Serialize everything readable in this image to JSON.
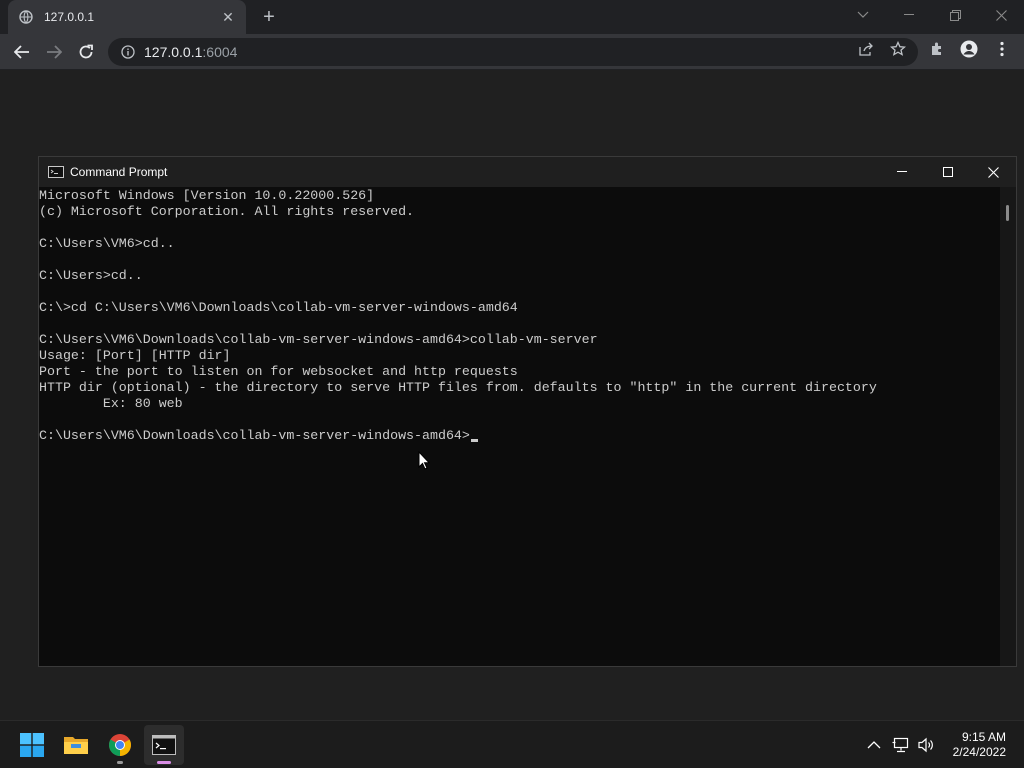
{
  "browser": {
    "tab_title": "127.0.0.1",
    "url_host": "127.0.0.1",
    "url_port": ":6004"
  },
  "cmd": {
    "title": "Command Prompt",
    "lines": [
      "Microsoft Windows [Version 10.0.22000.526]",
      "(c) Microsoft Corporation. All rights reserved.",
      "",
      "C:\\Users\\VM6>cd..",
      "",
      "C:\\Users>cd..",
      "",
      "C:\\>cd C:\\Users\\VM6\\Downloads\\collab-vm-server-windows-amd64",
      "",
      "C:\\Users\\VM6\\Downloads\\collab-vm-server-windows-amd64>collab-vm-server",
      "Usage: [Port] [HTTP dir]",
      "Port - the port to listen on for websocket and http requests",
      "HTTP dir (optional) - the directory to serve HTTP files from. defaults to \"http\" in the current directory",
      "        Ex: 80 web",
      "",
      "C:\\Users\\VM6\\Downloads\\collab-vm-server-windows-amd64>"
    ]
  },
  "taskbar": {
    "time": "9:15 AM",
    "date": "2/24/2022"
  },
  "colors": {
    "chrome_bg": "#202124",
    "toolbar_bg": "#35363a",
    "console_bg": "#0c0c0c",
    "console_text": "#cccccc",
    "taskbar_bg": "#1c1c1c"
  }
}
